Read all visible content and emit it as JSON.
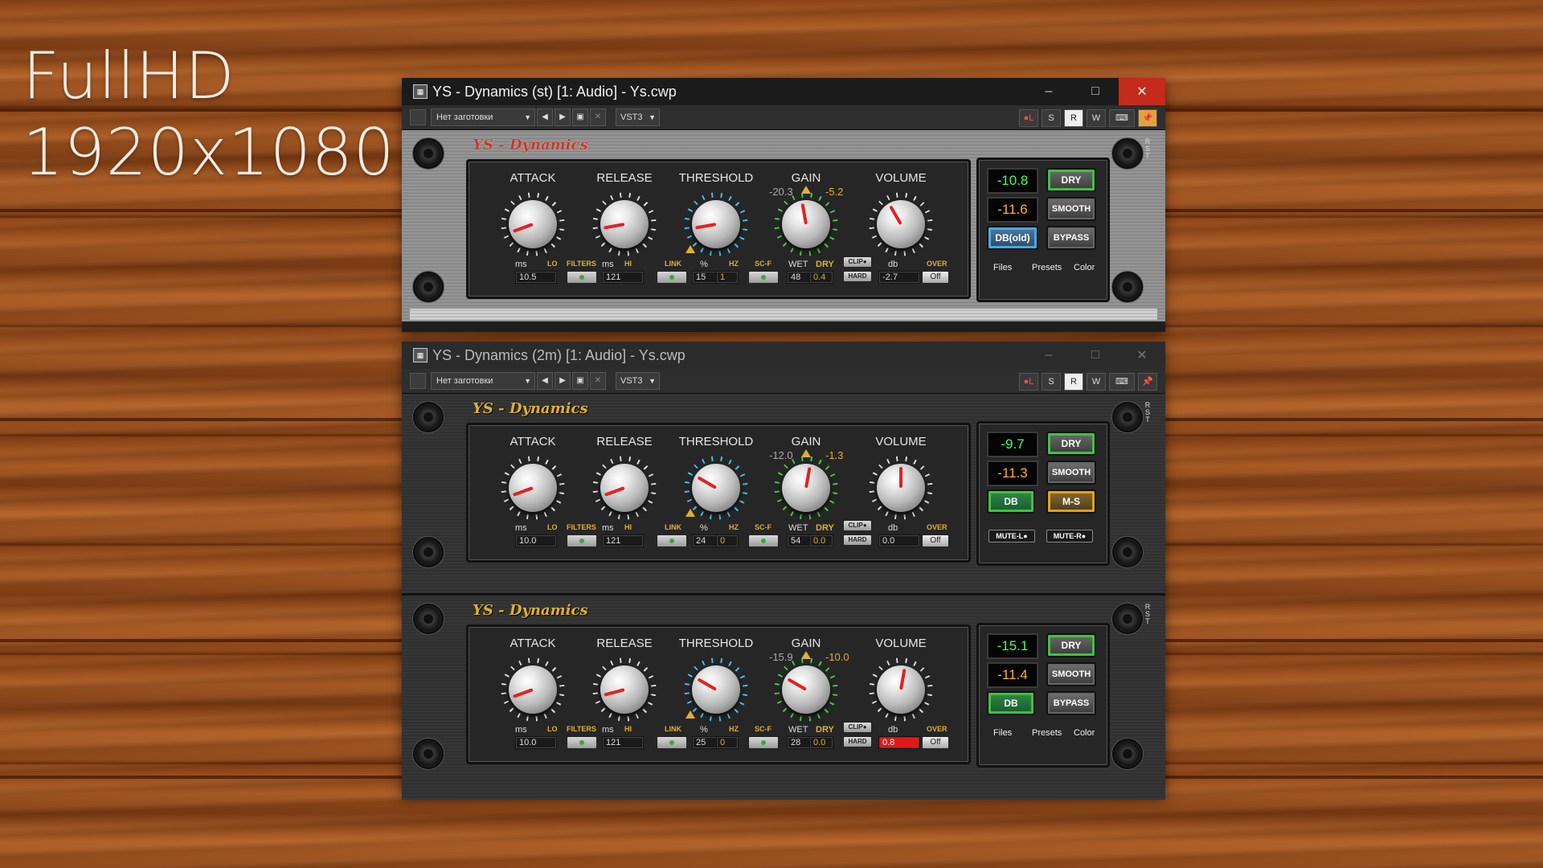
{
  "overlay": {
    "line1": "FullHD",
    "line2": "1920x1080"
  },
  "windows": [
    {
      "title": "YS - Dynamics (st) [1: Audio] - Ys.cwp",
      "active": true,
      "toolbar": {
        "preset": "Нет заготовки",
        "format": "VST3",
        "toggles": [
          "S",
          "R",
          "W"
        ]
      },
      "plugin": {
        "brand": "YS - Dynamics",
        "labels": {
          "attack": "ATTACK",
          "release": "RELEASE",
          "threshold": "THRESHOLD",
          "gain": "GAIN",
          "volume": "VOLUME"
        },
        "values": {
          "attack": "10.5",
          "release": "121",
          "threshold": "15",
          "threshold_hz": "1",
          "wet": "48",
          "dry": "0.4",
          "volume": "-2.7",
          "gain_left": "-20.3",
          "gain_right": "-5.2"
        },
        "readouts": [
          "-10.8",
          "-11.6"
        ],
        "buttons": [
          "DRY",
          "SMOOTH",
          "DB(old)",
          "BYPASS"
        ],
        "footer": [
          "Files",
          "Presets",
          "Color"
        ]
      }
    },
    {
      "title": "YS - Dynamics (2m) [1: Audio] - Ys.cwp",
      "active": false,
      "toolbar": {
        "preset": "Нет заготовки",
        "format": "VST3",
        "toggles": [
          "S",
          "R",
          "W"
        ]
      },
      "plugins": [
        {
          "brand": "YS - Dynamics",
          "values": {
            "attack": "10.0",
            "release": "121",
            "threshold": "24",
            "threshold_hz": "0",
            "wet": "54",
            "dry": "0.0",
            "volume": "0.0",
            "gain_left": "-12.0",
            "gain_right": "-1.3"
          },
          "readouts": [
            "-9.7",
            "-11.3"
          ],
          "buttons": [
            "DRY",
            "SMOOTH",
            "DB",
            "M-S"
          ],
          "mute": [
            "MUTE-L●",
            "MUTE-R●"
          ]
        },
        {
          "brand": "YS - Dynamics",
          "values": {
            "attack": "10.0",
            "release": "121",
            "threshold": "25",
            "threshold_hz": "0",
            "wet": "28",
            "dry": "0.0",
            "volume": "0.8",
            "gain_left": "-15.9",
            "gain_right": "-10.0"
          },
          "readouts": [
            "-15.1",
            "-11.4"
          ],
          "buttons": [
            "DRY",
            "SMOOTH",
            "DB",
            "BYPASS"
          ],
          "footer": [
            "Files",
            "Presets",
            "Color"
          ]
        }
      ]
    }
  ],
  "common": {
    "sub_ms": "ms",
    "sub_lo": "LO",
    "sub_hi": "HI",
    "sub_pct": "%",
    "sub_hz": "HZ",
    "sub_wet": "WET",
    "sub_dry": "DRY",
    "sub_db": "db",
    "filters": "FILTERS",
    "link": "LINK",
    "scf": "SC-F",
    "clip": "CLIP●",
    "hard": "HARD",
    "over": "OVER",
    "off": "Off",
    "labels": {
      "attack": "ATTACK",
      "release": "RELEASE",
      "threshold": "THRESHOLD",
      "gain": "GAIN",
      "volume": "VOLUME"
    },
    "rst": [
      "R",
      "S",
      "T"
    ]
  }
}
